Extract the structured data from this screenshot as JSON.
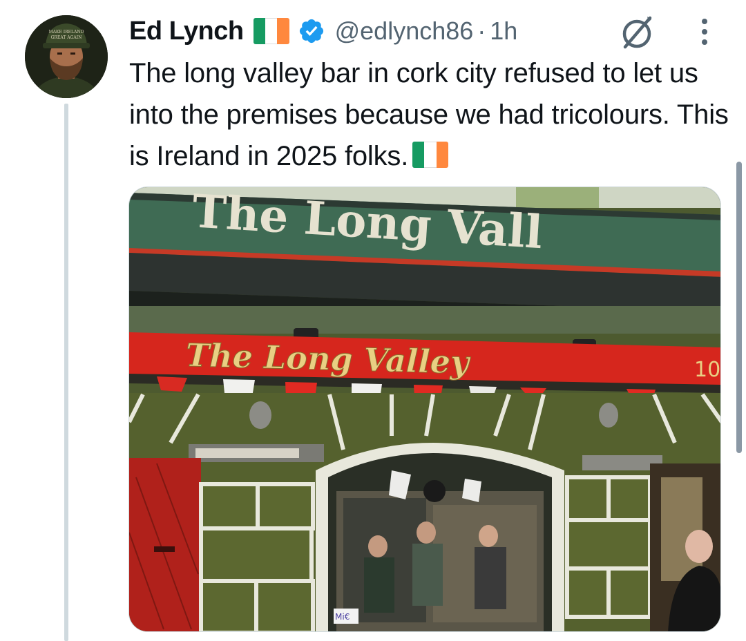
{
  "author": {
    "name": "Ed Lynch",
    "handle": "@edlynch86",
    "separator": "·",
    "time": "1h",
    "verified": true,
    "flag_colors": [
      "#169b62",
      "#ffffff",
      "#ff883e"
    ],
    "hat_text": [
      "MAKE IRELAND",
      "GREAT AGAIN"
    ]
  },
  "tweet": {
    "text": "The long valley bar in cork city refused to let us into the premises because we had tricolours. This is Ireland in 2025 folks."
  },
  "media": {
    "awning_text": "The Long Vall",
    "fascia_text": "The Long Valley",
    "fascia_number": "10",
    "door_sticker": "Mi€",
    "colors": {
      "awning": "#3f6b54",
      "fascia": "#d6261d",
      "gilt": "#e9cf83",
      "wall": "#55612e",
      "door": "#b0211b"
    }
  },
  "icons": {
    "verified": "verified-badge-icon",
    "grok": "grok-icon",
    "more": "more-options-icon"
  },
  "theme": {
    "accent": "#1d9bf0",
    "text": "#0f1419",
    "secondary": "#536471"
  }
}
